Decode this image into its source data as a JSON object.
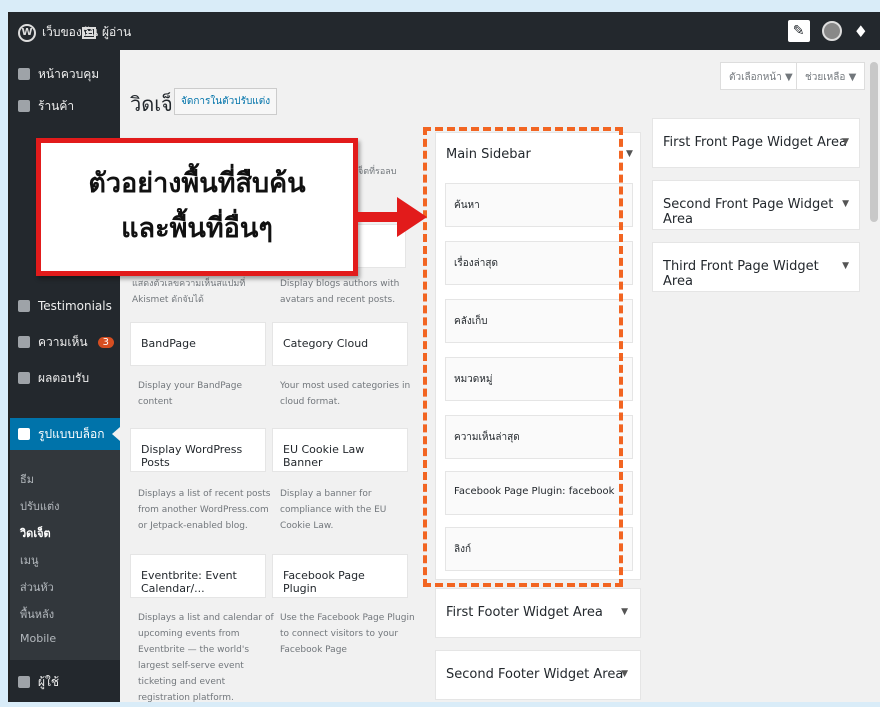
{
  "adminbar": {
    "site_label": "เว็บของฉัน",
    "reader_label": "ผู้อ่าน",
    "wp_glyph": "W",
    "write_glyph": "✎",
    "notify_glyph": "♦"
  },
  "sidebar": {
    "items": [
      {
        "label": "หน้าควบคุม",
        "icon": "dashboard-icon"
      },
      {
        "label": "ร้านค้า",
        "icon": "store-icon"
      },
      {
        "label": "Testimonials",
        "icon": "testimonials-icon"
      },
      {
        "label": "ความเห็น",
        "icon": "comments-icon",
        "badge": "3"
      },
      {
        "label": "ผลตอบรับ",
        "icon": "feedback-icon"
      },
      {
        "label": "รูปแบบบล็อก",
        "icon": "appearance-icon"
      },
      {
        "label": "ผู้ใช้",
        "icon": "users-icon"
      }
    ],
    "submenu": [
      "ธีม",
      "ปรับแต่ง",
      "วิดเจ็ต",
      "เมนู",
      "ส่วนหัว",
      "พื้นหลัง",
      "Mobile"
    ]
  },
  "header": {
    "title": "วิดเจ็ต",
    "manage_label": "จัดการในตัวปรับแต่ง",
    "screen_options": "ตัวเลือกหน้า ▼",
    "help": "ช่วยเหลือ ▼"
  },
  "available": {
    "partial_desc": "วิดเจ็ตที่รอลบ",
    "akismet_desc": "แสดงตัวเลขความเห็นสแปมที่ Akismet ดักจับได้",
    "authors_desc": "Display blogs authors with avatars and recent posts.",
    "widgets": [
      {
        "name": "BandPage",
        "desc": "Display your BandPage content"
      },
      {
        "name": "Category Cloud",
        "desc": "Your most used categories in cloud format."
      },
      {
        "name": "Display WordPress Posts",
        "desc": "Displays a list of recent posts from another WordPress.com or Jetpack-enabled blog."
      },
      {
        "name": "EU Cookie Law Banner",
        "desc": "Display a banner for compliance with the EU Cookie Law."
      },
      {
        "name": "Eventbrite: Event Calendar/...",
        "desc": "Displays a list and calendar of upcoming events from Eventbrite — the world's largest self-serve event ticketing and event registration platform."
      },
      {
        "name": "Facebook Page Plugin",
        "desc": "Use the Facebook Page Plugin to connect visitors to your Facebook Page"
      }
    ]
  },
  "main_sidebar": {
    "title": "Main Sidebar",
    "widgets": [
      "ค้นหา",
      "เรื่องล่าสุด",
      "คลังเก็บ",
      "หมวดหมู่",
      "ความเห็นล่าสุด",
      "Facebook Page Plugin: facebook",
      "ลิงก์"
    ]
  },
  "areas": {
    "first_footer": "First Footer Widget Area",
    "second_footer": "Second Footer Widget Area",
    "first_front": "First Front Page Widget Area",
    "second_front": "Second Front Page Widget Area",
    "third_front": "Third Front Page Widget Area"
  },
  "callout": {
    "line1": "ตัวอย่างพื้นที่สืบค้น",
    "line2": "และพื้นที่อื่นๆ"
  },
  "colors": {
    "accent": "#0073aa",
    "callout_border": "#e21b1b",
    "dash": "#f26522",
    "adminbar": "#23282d"
  }
}
